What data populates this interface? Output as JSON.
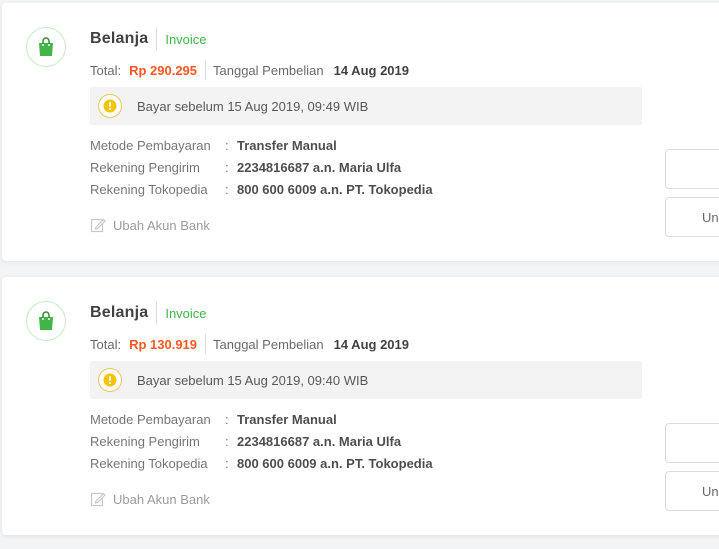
{
  "orders": [
    {
      "title": "Belanja",
      "invoice_label": "Invoice",
      "total_label": "Total:",
      "total_value": "Rp 290.295",
      "date_label": "Tanggal Pembelian",
      "date_value": "14 Aug 2019",
      "notice": "Bayar sebelum 15 Aug 2019, 09:49 WIB",
      "details": [
        {
          "label": "Metode Pembayaran",
          "value": "Transfer Manual"
        },
        {
          "label": "Rekening Pengirim",
          "value": "2234816687 a.n. Maria Ulfa"
        },
        {
          "label": "Rekening Tokopedia",
          "value": "800 600 6009 a.n. PT. Tokopedia"
        }
      ],
      "edit_label": "Ubah Akun Bank",
      "button1_label": "",
      "button2_label": "Un"
    },
    {
      "title": "Belanja",
      "invoice_label": "Invoice",
      "total_label": "Total:",
      "total_value": "Rp 130.919",
      "date_label": "Tanggal Pembelian",
      "date_value": "14 Aug 2019",
      "notice": "Bayar sebelum 15 Aug 2019, 09:40 WIB",
      "details": [
        {
          "label": "Metode Pembayaran",
          "value": "Transfer Manual"
        },
        {
          "label": "Rekening Pengirim",
          "value": "2234816687 a.n. Maria Ulfa"
        },
        {
          "label": "Rekening Tokopedia",
          "value": "800 600 6009 a.n. PT. Tokopedia"
        }
      ],
      "edit_label": "Ubah Akun Bank",
      "button1_label": "",
      "button2_label": "Un"
    }
  ],
  "detail_separator": ":",
  "colors": {
    "accent_green": "#42b549",
    "price_orange": "#ff5722",
    "notice_bg": "#f3f3f3",
    "bulb_yellow": "#f5c400"
  },
  "icons": {
    "order_icon": "shopping-bag-icon",
    "notice_icon": "lightbulb-icon",
    "edit_icon": "pencil-edit-icon"
  }
}
